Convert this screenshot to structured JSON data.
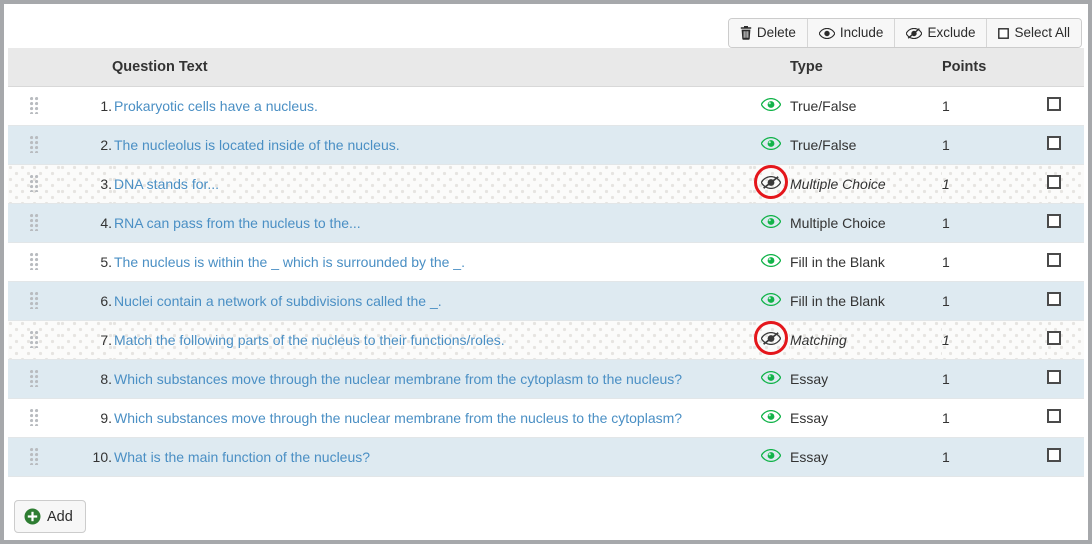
{
  "toolbar": {
    "buttons": [
      {
        "label": "Delete",
        "icon": "trash-icon"
      },
      {
        "label": "Include",
        "icon": "eye-icon"
      },
      {
        "label": "Exclude",
        "icon": "eye-slash-icon"
      },
      {
        "label": "Select All",
        "icon": "checkbox-icon"
      }
    ]
  },
  "table": {
    "headers": {
      "handle": "",
      "number": "",
      "question_text": "Question Text",
      "eye": "",
      "type": "Type",
      "points": "Points",
      "checkbox": ""
    },
    "rows": [
      {
        "number": "1.",
        "text": "Prokaryotic cells have a nucleus.",
        "type": "True/False",
        "points": "1",
        "included": true,
        "annotated": false,
        "checked": false
      },
      {
        "number": "2.",
        "text": "The nucleolus is located inside of the nucleus.",
        "type": "True/False",
        "points": "1",
        "included": true,
        "annotated": false,
        "checked": false
      },
      {
        "number": "3.",
        "text": "DNA stands for...",
        "type": "Multiple Choice",
        "points": "1",
        "included": false,
        "annotated": true,
        "checked": false
      },
      {
        "number": "4.",
        "text": "RNA can pass from the nucleus to the...",
        "type": "Multiple Choice",
        "points": "1",
        "included": true,
        "annotated": false,
        "checked": false
      },
      {
        "number": "5.",
        "text": "The nucleus is within the _ which is surrounded by the _.",
        "type": "Fill in the Blank",
        "points": "1",
        "included": true,
        "annotated": false,
        "checked": false
      },
      {
        "number": "6.",
        "text": "Nuclei contain a network of subdivisions called the _.",
        "type": "Fill in the Blank",
        "points": "1",
        "included": true,
        "annotated": false,
        "checked": false
      },
      {
        "number": "7.",
        "text": "Match the following parts of the nucleus to their functions/roles.",
        "type": "Matching",
        "points": "1",
        "included": false,
        "annotated": true,
        "checked": false
      },
      {
        "number": "8.",
        "text": "Which substances move through the nuclear membrane from the cytoplasm to the nucleus?",
        "type": "Essay",
        "points": "1",
        "included": true,
        "annotated": false,
        "checked": false
      },
      {
        "number": "9.",
        "text": "Which substances move through the nuclear membrane from the nucleus to the cytoplasm?",
        "type": "Essay",
        "points": "1",
        "included": true,
        "annotated": false,
        "checked": false
      },
      {
        "number": "10.",
        "text": "What is the main function of the nucleus?",
        "type": "Essay",
        "points": "1",
        "included": true,
        "annotated": false,
        "checked": false
      }
    ]
  },
  "footer": {
    "add_label": "Add",
    "add_icon": "plus-circle-icon"
  },
  "colors": {
    "link": "#4a8fc4",
    "row_alt": "#deeaf1",
    "header_bg": "#e9e9e9",
    "eye_included": "#12b34a",
    "eye_excluded": "#3a3a3a",
    "annotation_ring": "#e4161b",
    "add_icon_green": "#2e7d32",
    "page_bg": "#a6a8ab"
  }
}
